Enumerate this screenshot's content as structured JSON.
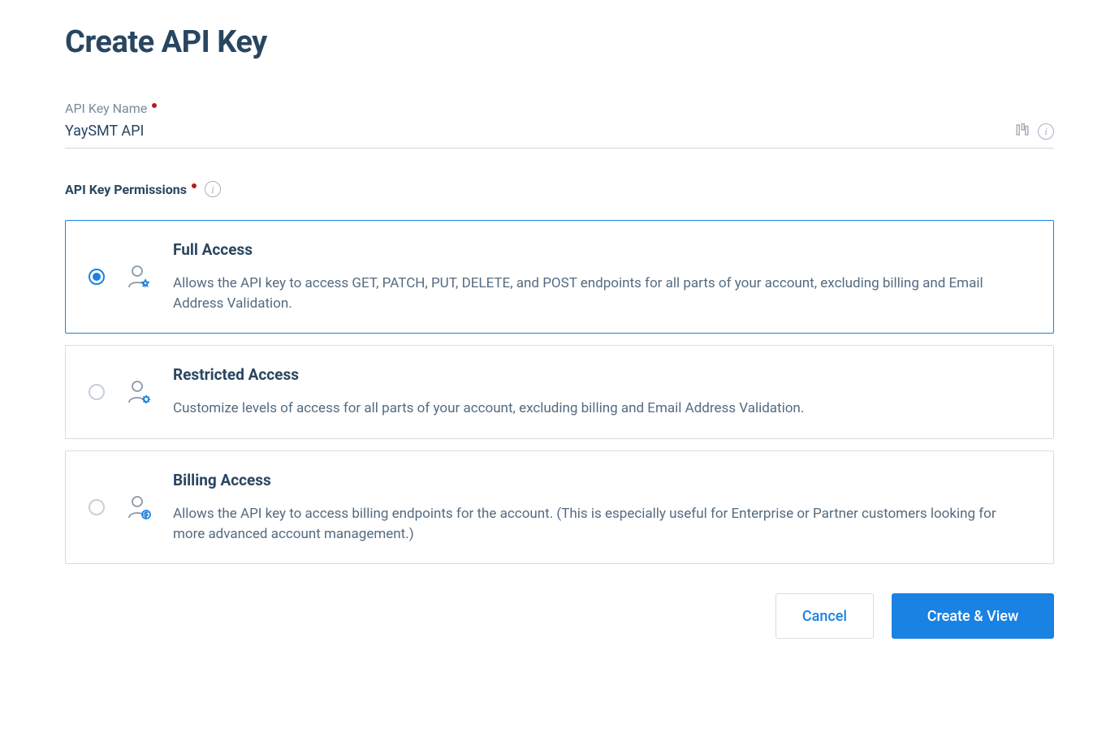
{
  "page": {
    "title": "Create API Key"
  },
  "name_field": {
    "label": "API Key Name",
    "value": "YaySMT API"
  },
  "permissions": {
    "label": "API Key Permissions",
    "options": [
      {
        "title": "Full Access",
        "description": "Allows the API key to access GET, PATCH, PUT, DELETE, and POST endpoints for all parts of your account, excluding billing and Email Address Validation."
      },
      {
        "title": "Restricted Access",
        "description": "Customize levels of access for all parts of your account, excluding billing and Email Address Validation."
      },
      {
        "title": "Billing Access",
        "description": "Allows the API key to access billing endpoints for the account. (This is especially useful for Enterprise or Partner customers looking for more advanced account management.)"
      }
    ],
    "selected_index": 0
  },
  "buttons": {
    "cancel": "Cancel",
    "submit": "Create & View"
  }
}
